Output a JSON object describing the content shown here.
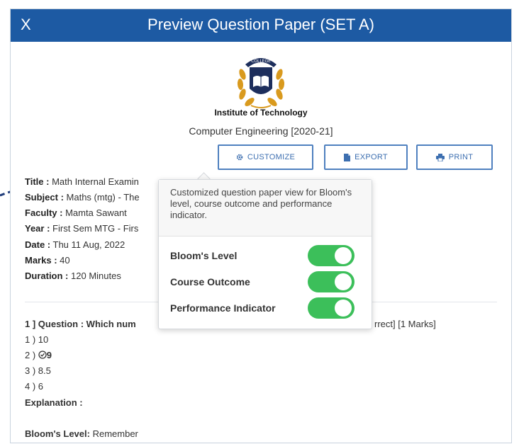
{
  "header": {
    "close_label": "X",
    "title": "Preview Question Paper (SET A)"
  },
  "institute": {
    "logo_text": "COLLEGE",
    "name": "Institute of Technology",
    "department": "Computer Engineering [2020-21]"
  },
  "toolbar": {
    "customize_label": "CUSTOMIZE",
    "export_label": "EXPORT",
    "print_label": "PRINT"
  },
  "paper_info": [
    {
      "label": "Title :",
      "value": "Math Internal Examin"
    },
    {
      "label": "Subject :",
      "value": "Maths (mtg) - The"
    },
    {
      "label": "Faculty :",
      "value": "Mamta Sawant"
    },
    {
      "label": "Year :",
      "value": "First Sem MTG - Firs"
    },
    {
      "label": "Date :",
      "value": "Thu 11 Aug, 2022"
    },
    {
      "label": "Marks :",
      "value": "40"
    },
    {
      "label": "Duration :",
      "value": "120  Minutes"
    }
  ],
  "question": {
    "heading_prefix": "1 ]  Question : Which num",
    "heading_suffix": "rrect] [1 Marks]",
    "options": [
      "1 ) 10",
      "2 )",
      "3 ) 8.5",
      "4 ) 6"
    ],
    "correct_option_value": "9",
    "explanation_label": "Explanation :",
    "bloom_label": "Bloom's Level:",
    "bloom_value": "Remember"
  },
  "customize_popover": {
    "description": "Customized question paper view for Bloom's level, course outcome and performance indicator.",
    "toggles": [
      {
        "label": "Bloom's Level",
        "enabled": true
      },
      {
        "label": "Course Outcome",
        "enabled": true
      },
      {
        "label": "Performance Indicator",
        "enabled": true
      }
    ]
  },
  "colors": {
    "header_bg": "#1d5aa3",
    "button_border": "#4f80bf",
    "toggle_on": "#3cbf5a",
    "arrow": "#1f3c7a"
  }
}
